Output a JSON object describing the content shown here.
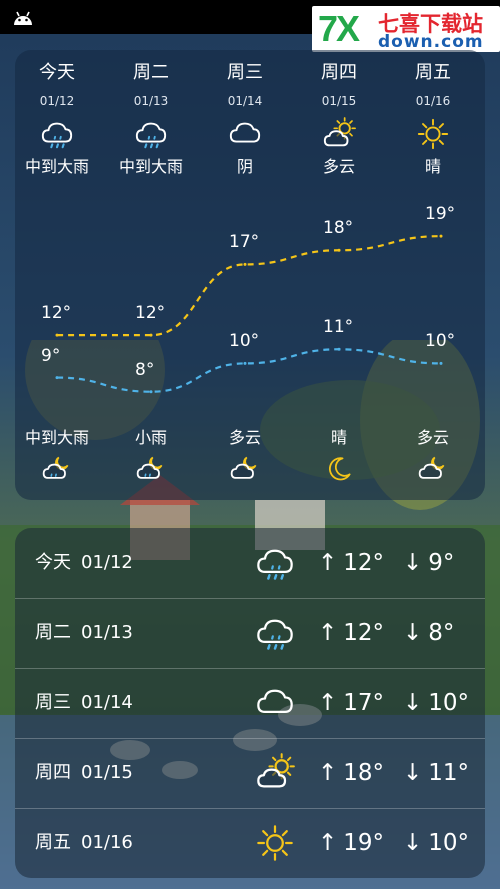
{
  "watermark": {
    "brand_7x": "7X",
    "brand_cn": "七喜下载站",
    "brand_en": "down.com"
  },
  "forecast_days": [
    {
      "name": "今天",
      "date": "01/12",
      "day_cond": "中到大雨",
      "day_icon": "rain-cloud-icon",
      "high": "12°",
      "low": "9°",
      "night_cond": "中到大雨",
      "night_icon": "night-rain-icon"
    },
    {
      "name": "周二",
      "date": "01/13",
      "day_cond": "中到大雨",
      "day_icon": "rain-cloud-icon",
      "high": "12°",
      "low": "8°",
      "night_cond": "小雨",
      "night_icon": "night-rain-icon"
    },
    {
      "name": "周三",
      "date": "01/14",
      "day_cond": "阴",
      "day_icon": "cloud-icon",
      "high": "17°",
      "low": "10°",
      "night_cond": "多云",
      "night_icon": "night-cloudy-icon"
    },
    {
      "name": "周四",
      "date": "01/15",
      "day_cond": "多云",
      "day_icon": "partly-sunny-icon",
      "high": "18°",
      "low": "11°",
      "night_cond": "晴",
      "night_icon": "moon-icon"
    },
    {
      "name": "周五",
      "date": "01/16",
      "day_cond": "晴",
      "day_icon": "sun-icon",
      "high": "19°",
      "low": "10°",
      "night_cond": "多云",
      "night_icon": "night-cloudy-icon"
    }
  ],
  "chart_data": {
    "type": "line",
    "categories": [
      "今天",
      "周二",
      "周三",
      "周四",
      "周五"
    ],
    "series": [
      {
        "values": [
          12,
          12,
          17,
          18,
          19
        ],
        "color": "#f5c518"
      },
      {
        "values": [
          9,
          8,
          10,
          11,
          10
        ],
        "color": "#4fb3e8"
      }
    ],
    "ylim": [
      6,
      20
    ]
  },
  "list_rows": [
    {
      "day": "今天",
      "date": "01/12",
      "icon": "rain-cloud-icon",
      "high": "12°",
      "low": "9°"
    },
    {
      "day": "周二",
      "date": "01/13",
      "icon": "rain-cloud-icon",
      "high": "12°",
      "low": "8°"
    },
    {
      "day": "周三",
      "date": "01/14",
      "icon": "cloud-icon",
      "high": "17°",
      "low": "10°"
    },
    {
      "day": "周四",
      "date": "01/15",
      "icon": "partly-sunny-icon",
      "high": "18°",
      "low": "11°"
    },
    {
      "day": "周五",
      "date": "01/16",
      "icon": "sun-icon",
      "high": "19°",
      "low": "10°"
    }
  ],
  "icons": {
    "up_arrow": "↑",
    "down_arrow": "↓"
  },
  "colors": {
    "high_line": "#f5c518",
    "low_line": "#4fb3e8"
  }
}
